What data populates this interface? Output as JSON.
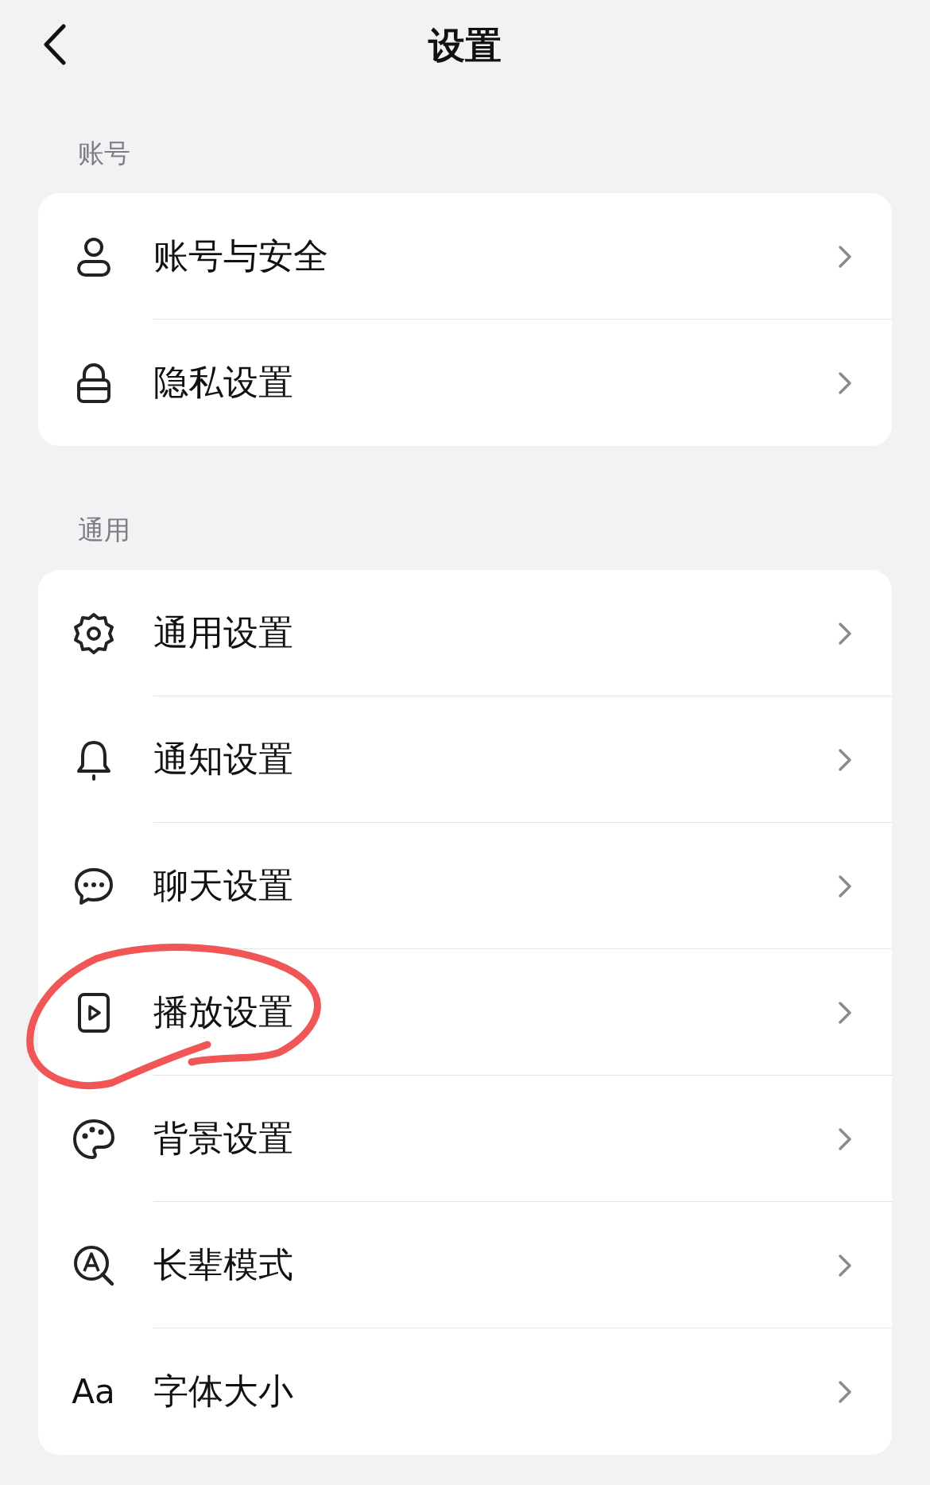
{
  "header": {
    "title": "设置"
  },
  "sections": [
    {
      "label": "账号",
      "items": [
        {
          "kind": "user",
          "label": "账号与安全",
          "circled": false
        },
        {
          "kind": "lock",
          "label": "隐私设置",
          "circled": false
        }
      ]
    },
    {
      "label": "通用",
      "items": [
        {
          "kind": "gear",
          "label": "通用设置",
          "circled": false
        },
        {
          "kind": "bell",
          "label": "通知设置",
          "circled": false
        },
        {
          "kind": "chat",
          "label": "聊天设置",
          "circled": false
        },
        {
          "kind": "play",
          "label": "播放设置",
          "circled": true
        },
        {
          "kind": "palette",
          "label": "背景设置",
          "circled": false
        },
        {
          "kind": "elder",
          "label": "长辈模式",
          "circled": false
        },
        {
          "kind": "text",
          "icon_text": "Aa",
          "label": "字体大小",
          "circled": false
        }
      ]
    }
  ]
}
